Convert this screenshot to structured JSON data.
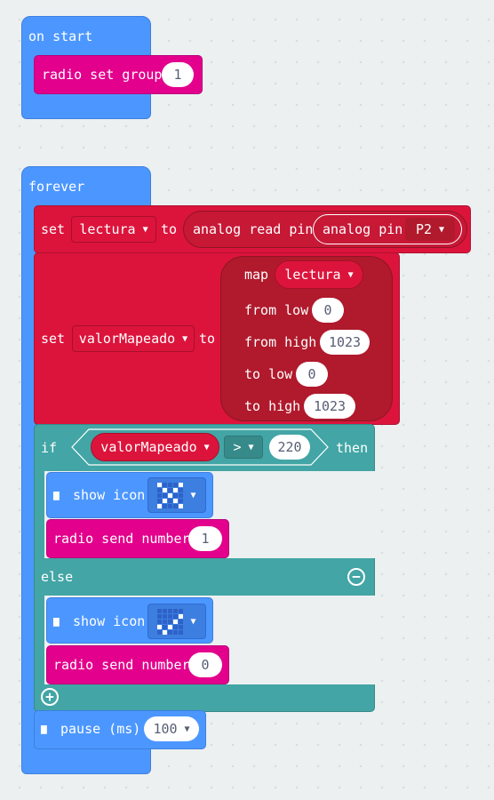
{
  "on_start": {
    "hat_label": "on start",
    "radio_set_group": {
      "label": "radio set group",
      "value": "1"
    }
  },
  "forever": {
    "hat_label": "forever",
    "set_lectura": {
      "set_label": "set",
      "variable": "lectura",
      "to_label": "to",
      "analog_read_label": "analog read pin",
      "analog_pin_label": "analog pin",
      "pin_value": "P2"
    },
    "set_mapeado": {
      "set_label": "set",
      "variable": "valorMapeado",
      "to_label": "to",
      "map_label": "map",
      "map_variable": "lectura",
      "from_low_label": "from low",
      "from_low_value": "0",
      "from_high_label": "from high",
      "from_high_value": "1023",
      "to_low_label": "to low",
      "to_low_value": "0",
      "to_high_label": "to high",
      "to_high_value": "1023"
    },
    "if_block": {
      "if_label": "if",
      "variable": "valorMapeado",
      "operator": ">",
      "compare_value": "220",
      "then_label": "then",
      "else_label": "else",
      "then_show_icon_label": "show icon",
      "then_radio_label": "radio send number",
      "then_radio_value": "1",
      "else_show_icon_label": "show icon",
      "else_radio_label": "radio send number",
      "else_radio_value": "0"
    },
    "pause": {
      "label": "pause (ms)",
      "value": "100"
    }
  },
  "icons": {
    "then_icon": [
      1,
      0,
      0,
      0,
      1,
      0,
      1,
      0,
      1,
      0,
      0,
      0,
      1,
      0,
      0,
      0,
      1,
      0,
      1,
      0,
      1,
      0,
      0,
      0,
      1
    ],
    "else_icon": [
      0,
      0,
      0,
      0,
      0,
      0,
      0,
      0,
      0,
      1,
      0,
      0,
      0,
      1,
      0,
      1,
      0,
      1,
      0,
      0,
      0,
      1,
      0,
      0,
      0
    ]
  },
  "colors": {
    "basic_blue": "#4c97ff",
    "radio_pink": "#e3008c",
    "variables_red": "#dc143c",
    "logic_teal": "#43a5a5"
  }
}
